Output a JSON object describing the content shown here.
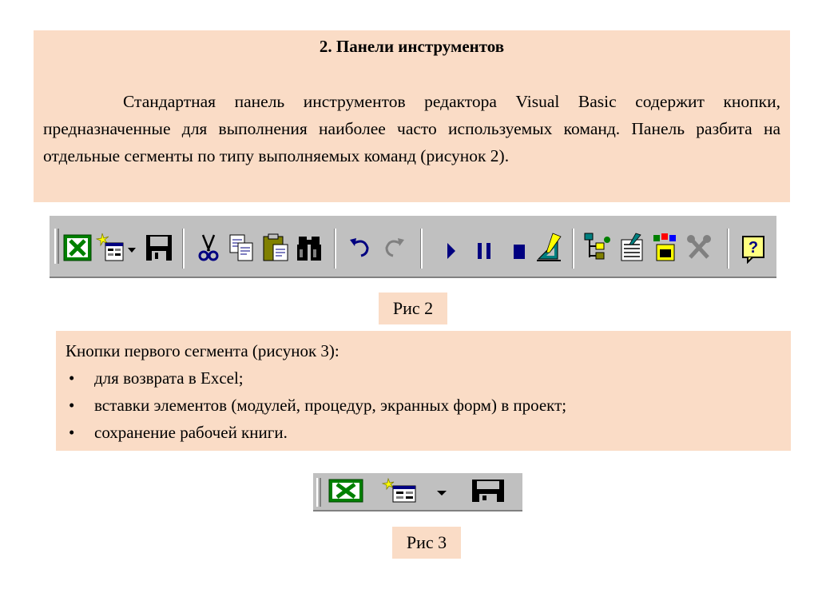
{
  "intro": {
    "title": "2. Панели инструментов",
    "text": "Стандартная панель инструментов редактора Visual Basic содержит кнопки, предназначенные для выполнения наиболее часто используемых команд. Панель разбита на отдельные сегменты по типу выполняемых команд (рисунок 2)."
  },
  "figure2": {
    "caption": "Рис 2"
  },
  "segment": {
    "heading": "Кнопки первого сегмента (рисунок 3):",
    "items": [
      "для возврата в Excel;",
      "вставки элементов (модулей, процедур, экранных форм) в проект;",
      "сохранение рабочей книги."
    ]
  },
  "figure3": {
    "caption": "Рис 3"
  },
  "toolbar_icons": [
    "excel-icon",
    "insert-module-icon",
    "dropdown-arrow-icon",
    "save-icon",
    "cut-icon",
    "copy-icon",
    "paste-icon",
    "find-icon",
    "undo-icon",
    "redo-icon",
    "run-icon",
    "pause-icon",
    "stop-icon",
    "design-mode-icon",
    "project-explorer-icon",
    "properties-window-icon",
    "object-browser-icon",
    "toolbox-icon",
    "help-icon"
  ],
  "colors": {
    "panel": "#fadcc6",
    "toolbar": "#c0c0c0",
    "icon_blue": "#000080",
    "excel_green": "#008000"
  }
}
